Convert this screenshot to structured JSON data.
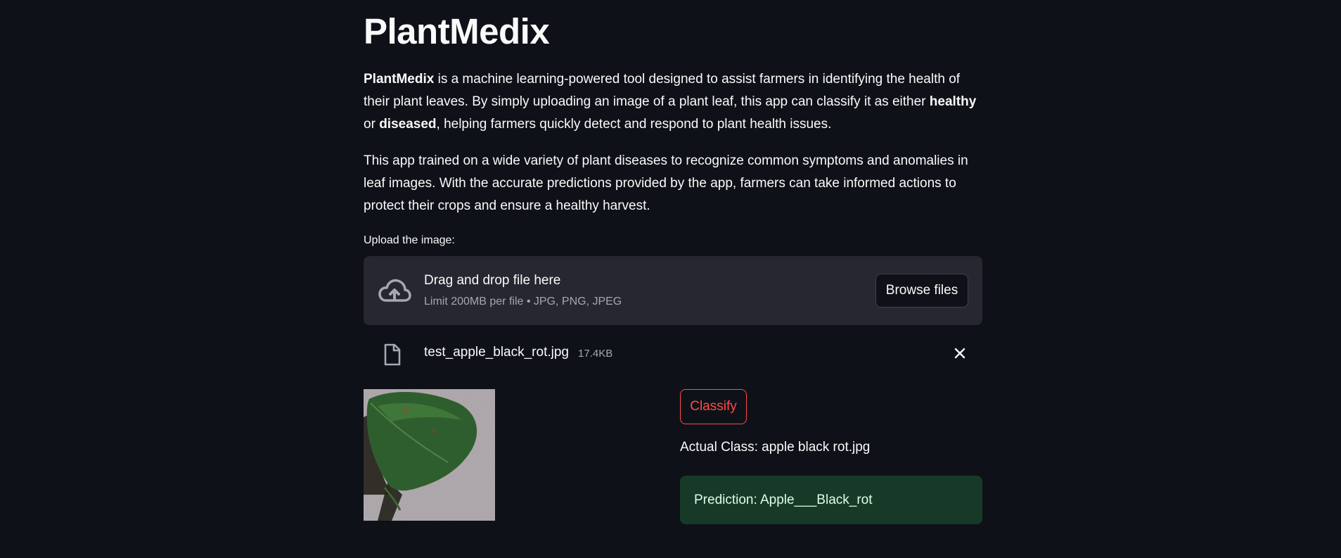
{
  "app": {
    "title": "PlantMedix"
  },
  "intro": {
    "p1": {
      "name": "PlantMedix",
      "text1": " is a machine learning-powered tool designed to assist farmers in identifying the health of their plant leaves. By simply uploading an image of a plant leaf, this app can classify it as either ",
      "healthy": "healthy",
      "text2": " or ",
      "diseased": "diseased",
      "text3": ", helping farmers quickly detect and respond to plant health issues."
    },
    "p2": "This app trained on a wide variety of plant diseases to recognize common symptoms and anomalies in leaf images. With the accurate predictions provided by the app, farmers can take informed actions to protect their crops and ensure a healthy harvest."
  },
  "uploader": {
    "label": "Upload the image:",
    "drop_title": "Drag and drop file here",
    "drop_subtitle": "Limit 200MB per file • JPG, PNG, JPEG",
    "browse_label": "Browse files",
    "cloud_icon": "cloud-upload-icon"
  },
  "uploaded_file": {
    "name": "test_apple_black_rot.jpg",
    "size": "17.4KB",
    "file_icon": "file-icon",
    "close_icon": "close-icon"
  },
  "result": {
    "classify_label": "Classify",
    "actual_class": "Actual Class: apple black rot.jpg",
    "prediction": "Prediction: Apple___Black_rot"
  },
  "colors": {
    "background": "#0e1117",
    "panel": "#262730",
    "accent_red": "#ff4b4b",
    "success_bg": "#173928",
    "success_text": "#dffde9"
  }
}
